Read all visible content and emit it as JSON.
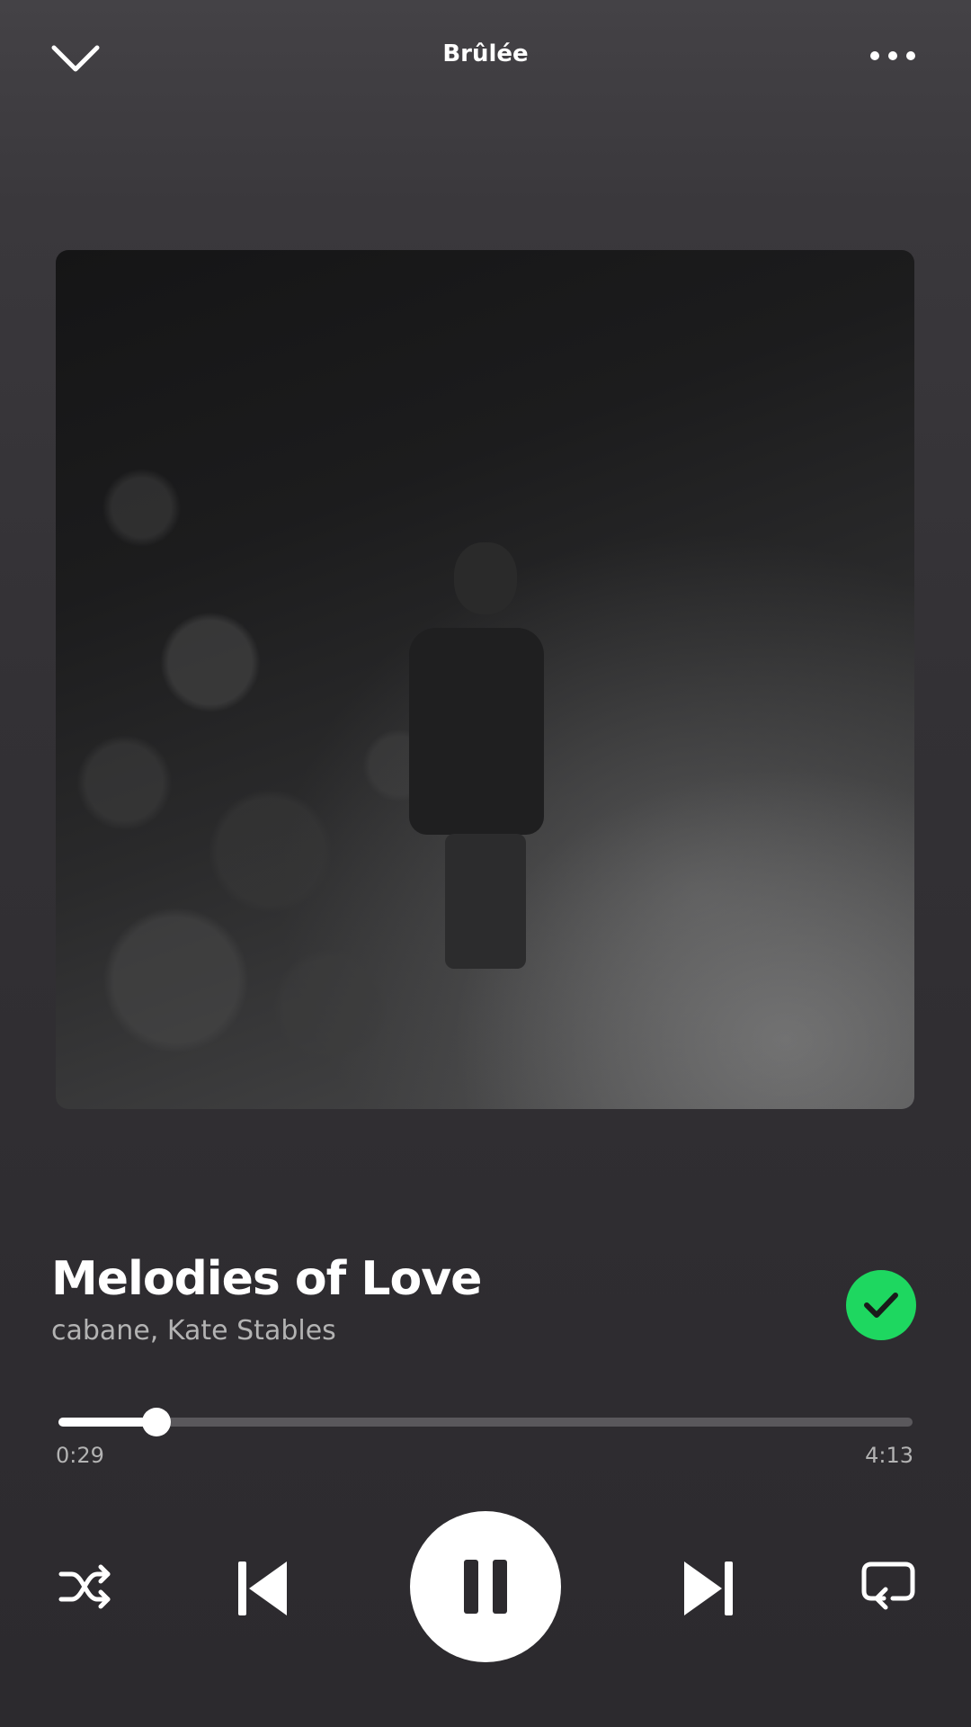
{
  "header": {
    "title": "Brûlée",
    "collapse_icon": "chevron-down-icon",
    "more_icon": "more-horizontal-icon"
  },
  "artwork": {
    "description": "album cover"
  },
  "track": {
    "title": "Melodies of Love",
    "artist": "cabane, Kate Stables",
    "liked": true,
    "liked_icon": "check-icon"
  },
  "progress": {
    "elapsed": "0:29",
    "total": "4:13",
    "fraction": 0.1146
  },
  "controls": {
    "shuffle_icon": "shuffle-icon",
    "previous_icon": "skip-previous-icon",
    "play_state_icon": "pause-icon",
    "next_icon": "skip-next-icon",
    "repeat_icon": "repeat-icon"
  },
  "colors": {
    "accent": "#1ed760",
    "text_secondary": "#b3b3b3",
    "background": "#333135"
  }
}
